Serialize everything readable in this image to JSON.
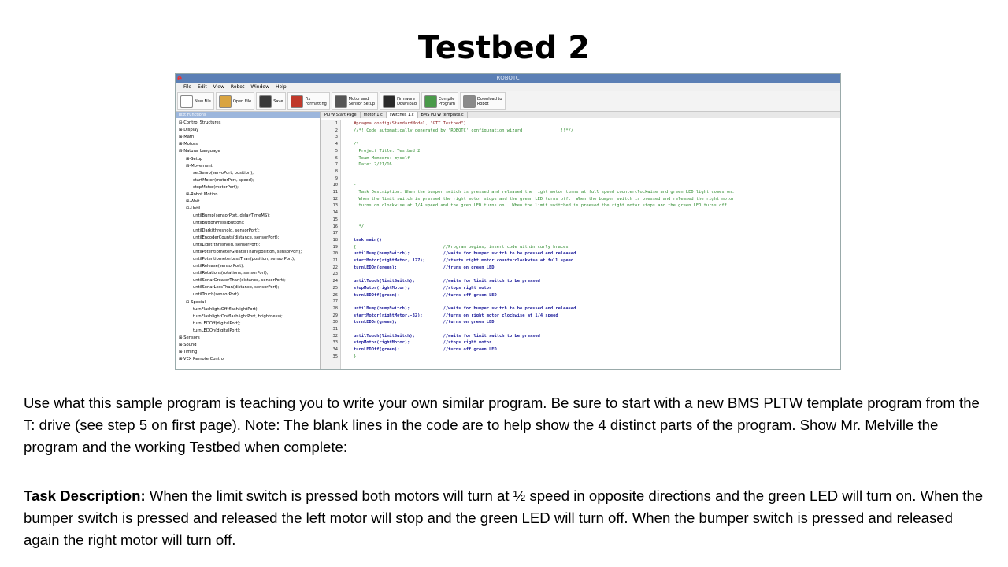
{
  "slide": {
    "title": "Testbed 2",
    "paragraph1": "Use what this sample program is teaching you to write your own similar program.  Be sure to start with a new BMS PLTW template program from the T: drive (see step 5 on first page).  Note: The blank lines in the code are to help show the 4 distinct parts of the program.  Show Mr. Melville the program and the working Testbed when complete:",
    "task_label": "Task Description:",
    "task_text": "  When the limit switch is pressed both motors will turn at ½ speed in opposite directions and the green LED will turn on.  When the bumper switch is pressed and released the left motor will stop and the green LED will turn off.  When the bumper switch is pressed and released again the right motor will turn off."
  },
  "window": {
    "title": "ROBOTC",
    "menu": [
      "File",
      "Edit",
      "View",
      "Robot",
      "Window",
      "Help"
    ],
    "toolbar": [
      {
        "label": "New File",
        "icon": "new-file-icon",
        "color": "#ffffff"
      },
      {
        "label": "Open File",
        "icon": "open-folder-icon",
        "color": "#d9a441"
      },
      {
        "label": "Save",
        "icon": "save-icon",
        "color": "#3a3a3a"
      },
      {
        "label": "Fix\nFormatting",
        "icon": "magic-wand-icon",
        "color": "#c0392b"
      },
      {
        "label": "Motor and\nSensor Setup",
        "icon": "motor-icon",
        "color": "#555555"
      },
      {
        "label": "Firmware\nDownload",
        "icon": "firmware-icon",
        "color": "#2a2a2a"
      },
      {
        "label": "Compile\nProgram",
        "icon": "compile-icon",
        "color": "#4a9a4a"
      },
      {
        "label": "Download to\nRobot",
        "icon": "download-robot-icon",
        "color": "#8a8a8a"
      }
    ],
    "tabs": [
      "PLTW Start Page",
      "motor 1.c",
      "switches 1.c",
      "BMS PLTW template.c"
    ],
    "active_tab": 2,
    "tree_header": "Text Functions",
    "tree": [
      {
        "t": "⊟-Control Structures",
        "d": 0
      },
      {
        "t": "⊞-Display",
        "d": 0
      },
      {
        "t": "⊞-Math",
        "d": 0
      },
      {
        "t": "⊞-Motors",
        "d": 0
      },
      {
        "t": "⊟-Natural Language",
        "d": 0
      },
      {
        "t": "⊞-Setup",
        "d": 1
      },
      {
        "t": "⊟-Movement",
        "d": 1
      },
      {
        "t": "setServo(servoPort, position);",
        "d": 2
      },
      {
        "t": "startMotor(motorPort, speed);",
        "d": 2
      },
      {
        "t": "stopMotor(motorPort);",
        "d": 2
      },
      {
        "t": "⊞-Robot Motion",
        "d": 1
      },
      {
        "t": "⊞-Wait",
        "d": 1
      },
      {
        "t": "⊟-Until",
        "d": 1
      },
      {
        "t": "untilBump(sensorPort, delayTimeMS);",
        "d": 2
      },
      {
        "t": "untilButtonPress(button);",
        "d": 2
      },
      {
        "t": "untilDark(threshold, sensorPort);",
        "d": 2
      },
      {
        "t": "untilEncoderCounts(distance, sensorPort);",
        "d": 2
      },
      {
        "t": "untilLight(threshold, sensorPort);",
        "d": 2
      },
      {
        "t": "untilPotentiometerGreaterThan(position, sensorPort);",
        "d": 2
      },
      {
        "t": "untilPotentiometerLessThan(position, sensorPort);",
        "d": 2
      },
      {
        "t": "untilRelease(sensorPort);",
        "d": 2
      },
      {
        "t": "untilRotations(rotations, sensorPort);",
        "d": 2
      },
      {
        "t": "untilSonarGreaterThan(distance, sensorPort);",
        "d": 2
      },
      {
        "t": "untilSonarLessThan(distance, sensorPort);",
        "d": 2
      },
      {
        "t": "untilTouch(sensorPort);",
        "d": 2
      },
      {
        "t": "⊟-Special",
        "d": 1
      },
      {
        "t": "turnFlashlightOff(flashlightPort);",
        "d": 2
      },
      {
        "t": "turnFlashlightOn(flashlightPort, brightness);",
        "d": 2
      },
      {
        "t": "turnLEDOff(digitalPort);",
        "d": 2
      },
      {
        "t": "turnLEDOn(digitalPort);",
        "d": 2
      },
      {
        "t": "⊞-Sensors",
        "d": 0
      },
      {
        "t": "⊞-Sound",
        "d": 0
      },
      {
        "t": "⊞-Timing",
        "d": 0
      },
      {
        "t": "⊞-VEX Remote Control",
        "d": 0
      }
    ],
    "code": [
      {
        "n": "1",
        "s": "#pragma config(StandardModel, \"GTT Testbed\")",
        "c": "hl"
      },
      {
        "n": "2",
        "s": "//*!!Code automatically generated by 'ROBOTC' configuration wizard               !!*//",
        "c": "cm"
      },
      {
        "n": "3",
        "s": "",
        "c": ""
      },
      {
        "n": "4",
        "s": "/*",
        "c": "cm"
      },
      {
        "n": "5",
        "s": "  Project Title: Testbed 2",
        "c": "cm"
      },
      {
        "n": "6",
        "s": "  Team Members: myself",
        "c": "cm"
      },
      {
        "n": "7",
        "s": "  Date: 2/21/16",
        "c": "cm"
      },
      {
        "n": "8",
        "s": "",
        "c": ""
      },
      {
        "n": "9",
        "s": "",
        "c": ""
      },
      {
        "n": "10",
        "s": "-",
        "c": "cm"
      },
      {
        "n": "11",
        "s": "  Task Description: When the bumper switch is pressed and released the right motor turns at full speed counterclockwise and green LED light comes on.",
        "c": "cm"
      },
      {
        "n": "12",
        "s": "  When the limit switch is pressed the right motor stops and the green LED turns off.  When the bumper switch is pressed and released the right motor",
        "c": "cm"
      },
      {
        "n": "13",
        "s": "  turns on clockwise at 1/4 speed and the gren LED turns on.  When the limit switched is preesed the right motor stops and the green LED turns off.",
        "c": "cm"
      },
      {
        "n": "14",
        "s": "",
        "c": ""
      },
      {
        "n": "15",
        "s": "",
        "c": ""
      },
      {
        "n": "16",
        "s": "  */",
        "c": "cm"
      },
      {
        "n": "17",
        "s": "",
        "c": ""
      },
      {
        "n": "18",
        "s": "task main()",
        "c": "kw"
      },
      {
        "n": "19",
        "s": "{                                  //Program begins, insert code within curly braces",
        "c": "cm"
      },
      {
        "n": "20",
        "s": "untilBump(bumpSwitch);             //waits for bumper switch to be pressed and released",
        "c": "mix"
      },
      {
        "n": "21",
        "s": "startMotor(rightMotor, 127);       //starts right motor counterclockwise at full speed",
        "c": "mix"
      },
      {
        "n": "22",
        "s": "turnLEDOn(green);                  //truns on green LED",
        "c": "mix"
      },
      {
        "n": "23",
        "s": "",
        "c": ""
      },
      {
        "n": "24",
        "s": "untilTouch(limitSwitch);           //waits for limit switch to be pressed",
        "c": "mix"
      },
      {
        "n": "25",
        "s": "stopMotor(rightMotor);             //stops right motor",
        "c": "mix"
      },
      {
        "n": "26",
        "s": "turnLEDOff(green);                 //turns off green LED",
        "c": "mix"
      },
      {
        "n": "27",
        "s": "",
        "c": ""
      },
      {
        "n": "28",
        "s": "untilBump(bumpSwitch);             //waits for bumper switch to be pressed and released",
        "c": "mix"
      },
      {
        "n": "29",
        "s": "startMotor(rightMotor,-32);        //turns on right motor clockwise at 1/4 speed",
        "c": "mix"
      },
      {
        "n": "30",
        "s": "turnLEDOn(green);                  //turns on green LED",
        "c": "mix"
      },
      {
        "n": "31",
        "s": "",
        "c": ""
      },
      {
        "n": "32",
        "s": "untilTouch(limitSwitch);           //waits for limit switch to be pressed",
        "c": "mix"
      },
      {
        "n": "33",
        "s": "stopMotor(rightMotor);             //stops right motor",
        "c": "mix"
      },
      {
        "n": "34",
        "s": "turnLEDOff(green);                 //turns off green LED",
        "c": "mix"
      },
      {
        "n": "35",
        "s": "}",
        "c": "cm"
      }
    ]
  }
}
